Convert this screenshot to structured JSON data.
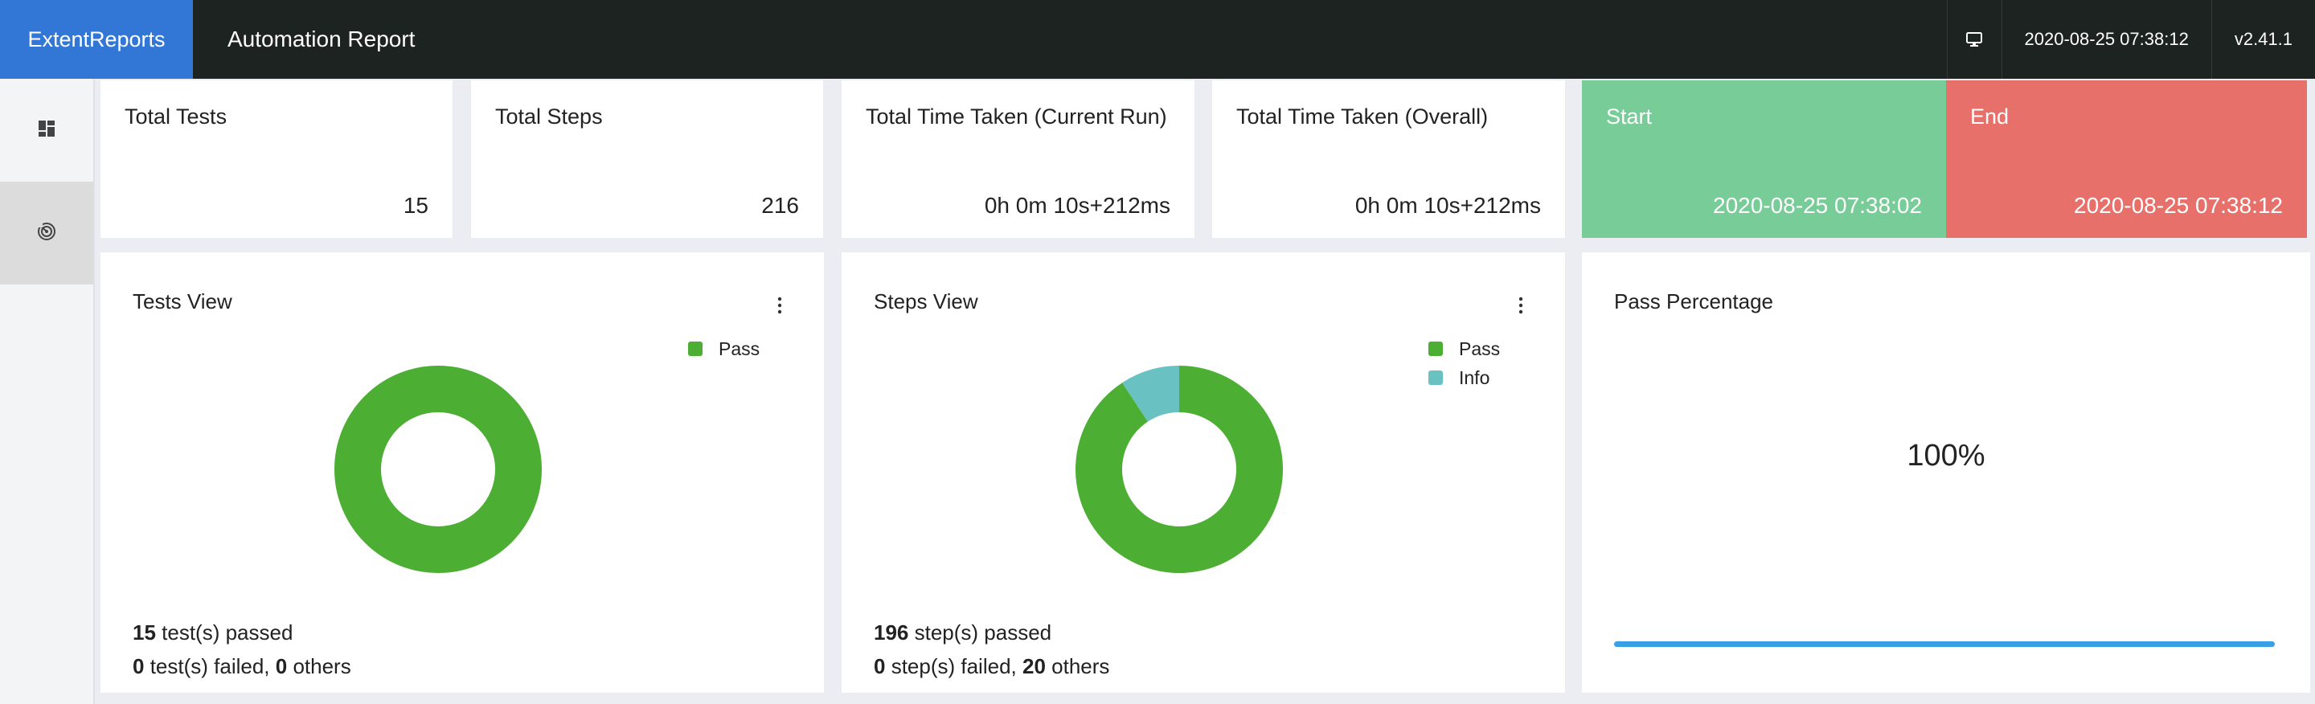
{
  "header": {
    "brand": "ExtentReports",
    "title": "Automation Report",
    "timestamp": "2020-08-25 07:38:12",
    "version": "v2.41.1",
    "monitor_icon": "monitor-icon"
  },
  "sidebar": {
    "items": [
      {
        "icon": "dashboard-icon",
        "active": false
      },
      {
        "icon": "radar-icon",
        "active": true
      }
    ]
  },
  "stats": {
    "total_tests": {
      "label": "Total Tests",
      "value": "15"
    },
    "total_steps": {
      "label": "Total Steps",
      "value": "216"
    },
    "time_current": {
      "label": "Total Time Taken (Current Run)",
      "value": "0h 0m 10s+212ms"
    },
    "time_overall": {
      "label": "Total Time Taken (Overall)",
      "value": "0h 0m 10s+212ms"
    },
    "start": {
      "label": "Start",
      "value": "2020-08-25 07:38:02"
    },
    "end": {
      "label": "End",
      "value": "2020-08-25 07:38:12"
    }
  },
  "tests_view": {
    "title": "Tests View",
    "legend": [
      {
        "label": "Pass",
        "color": "#4cae32"
      }
    ],
    "passed_count": "15",
    "passed_text": " test(s) passed",
    "failed_count": "0",
    "failed_text": " test(s) failed, ",
    "others_count": "0",
    "others_text": " others"
  },
  "steps_view": {
    "title": "Steps View",
    "legend": [
      {
        "label": "Pass",
        "color": "#4cae32"
      },
      {
        "label": "Info",
        "color": "#6ac1c2"
      }
    ],
    "passed_count": "196",
    "passed_text": " step(s) passed",
    "failed_count": "0",
    "failed_text": " step(s) failed, ",
    "others_count": "20",
    "others_text": " others"
  },
  "pass_percentage": {
    "title": "Pass Percentage",
    "value": "100%",
    "progress": 1.0,
    "color": "#3aa0e6"
  },
  "chart_data": [
    {
      "type": "pie",
      "title": "Tests View",
      "categories": [
        "Pass"
      ],
      "values": [
        15
      ],
      "colors": [
        "#4cae32"
      ],
      "legend": "top-right"
    },
    {
      "type": "pie",
      "title": "Steps View",
      "categories": [
        "Pass",
        "Info"
      ],
      "values": [
        196,
        20
      ],
      "colors": [
        "#4cae32",
        "#6ac1c2"
      ],
      "legend": "top-right"
    }
  ]
}
